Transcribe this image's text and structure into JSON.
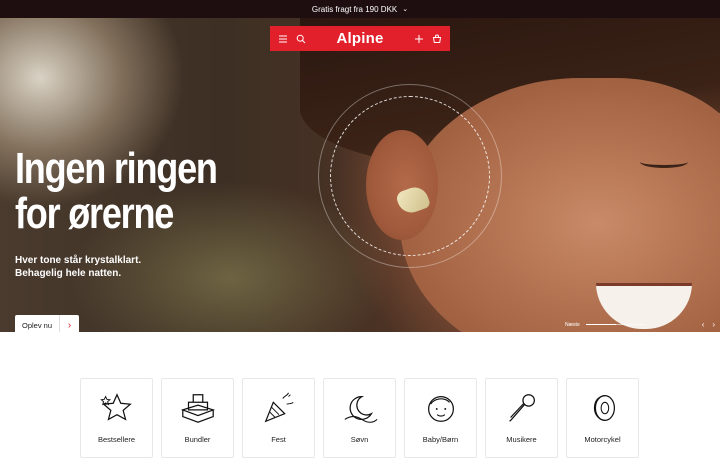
{
  "topbar": {
    "text": "Gratis fragt fra 190 DKK",
    "chevron": "chevron-down-icon"
  },
  "header": {
    "logo": "Alpine",
    "brand_color": "#e1202b",
    "icons": [
      "menu-icon",
      "search-icon",
      "plus-icon",
      "cart-icon"
    ]
  },
  "hero": {
    "title_line1": "Ingen ringen",
    "title_line2": "for ørerne",
    "subtitle_line1": "Hver tone står krystalklart.",
    "subtitle_line2": "Behagelig hele natten.",
    "cta_label": "Oplev nu",
    "next_label": "Næste",
    "slide_progress": 0.5
  },
  "categories": [
    {
      "label": "Bestsellere",
      "icon": "stars-icon"
    },
    {
      "label": "Bundler",
      "icon": "boxes-icon"
    },
    {
      "label": "Fest",
      "icon": "party-popper-icon"
    },
    {
      "label": "Søvn",
      "icon": "moon-icon"
    },
    {
      "label": "Baby/Børn",
      "icon": "child-face-icon"
    },
    {
      "label": "Musikere",
      "icon": "microphone-icon"
    },
    {
      "label": "Motorcykel",
      "icon": "tire-icon"
    }
  ]
}
